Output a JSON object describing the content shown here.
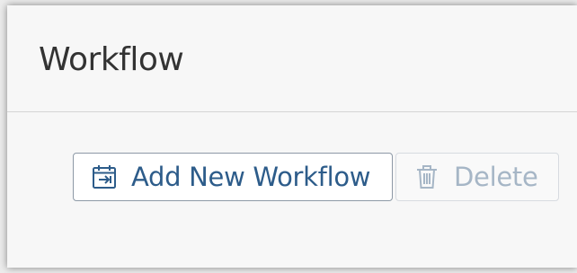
{
  "panel": {
    "title": "Workflow"
  },
  "toolbar": {
    "add_label": "Add New Workflow",
    "add_icon": "calendar-arrow-icon",
    "delete_label": "Delete",
    "delete_icon": "trash-icon"
  },
  "colors": {
    "accent": "#2d5c8a",
    "disabled": "#a6b6c6"
  }
}
